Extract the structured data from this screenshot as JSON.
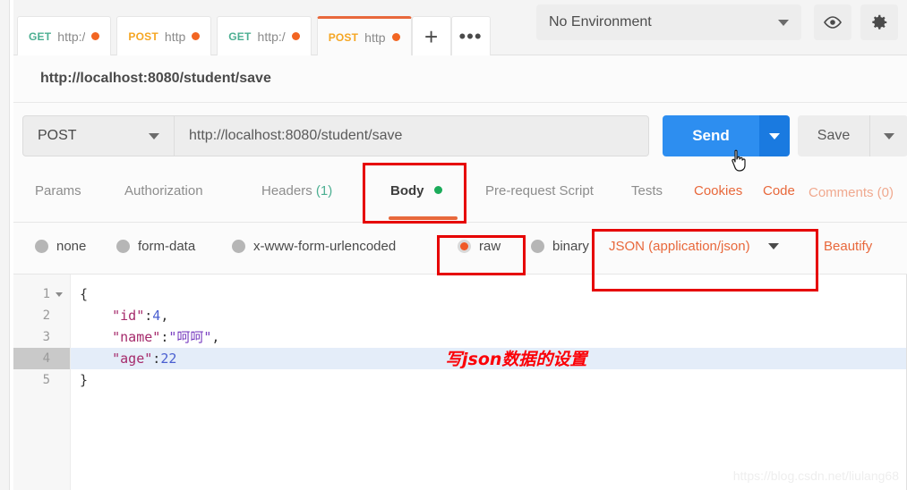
{
  "window": {
    "tabs": [
      {
        "method": "GET",
        "label": "http:/",
        "has_dot": true,
        "active": false
      },
      {
        "method": "POST",
        "label": "http",
        "has_dot": true,
        "active": false
      },
      {
        "method": "GET",
        "label": "http:/",
        "has_dot": true,
        "active": false
      },
      {
        "method": "POST",
        "label": "http",
        "has_dot": true,
        "active": true
      }
    ],
    "new_tab_label": "+",
    "more_tabs_label": "•••",
    "environment": {
      "selected": "No Environment",
      "eye_icon": "eye-icon",
      "gear_icon": "gear-icon"
    }
  },
  "breadcrumb": {
    "title": "http://localhost:8080/student/save"
  },
  "request": {
    "method": "POST",
    "url": "http://localhost:8080/student/save",
    "send_label": "Send",
    "save_label": "Save"
  },
  "request_tabs": {
    "items": [
      {
        "label": "Params",
        "active": false
      },
      {
        "label": "Authorization",
        "active": false
      },
      {
        "label": "Headers",
        "active": false,
        "count": "(1)"
      },
      {
        "label": "Body",
        "active": true,
        "dot": true
      },
      {
        "label": "Pre-request Script",
        "active": false
      },
      {
        "label": "Tests",
        "active": false
      }
    ],
    "links": [
      {
        "label": "Cookies",
        "muted": false
      },
      {
        "label": "Code",
        "muted": false
      },
      {
        "label": "Comments (0)",
        "muted": true
      }
    ]
  },
  "body_options": {
    "radios": [
      {
        "label": "none",
        "selected": false
      },
      {
        "label": "form-data",
        "selected": false
      },
      {
        "label": "x-www-form-urlencoded",
        "selected": false
      },
      {
        "label": "raw",
        "selected": true
      },
      {
        "label": "binary",
        "selected": false
      }
    ],
    "content_type": "JSON (application/json)",
    "beautify_label": "Beautify"
  },
  "editor": {
    "active_line": 4,
    "lines": [
      {
        "number": "1",
        "fold": true,
        "tokens": [
          {
            "t": "{",
            "c": "punc"
          }
        ]
      },
      {
        "number": "2",
        "fold": false,
        "tokens": [
          {
            "t": "    \"id\"",
            "c": "k"
          },
          {
            "t": ":",
            "c": "punc"
          },
          {
            "t": "4",
            "c": "num"
          },
          {
            "t": ",",
            "c": "punc"
          }
        ]
      },
      {
        "number": "3",
        "fold": false,
        "tokens": [
          {
            "t": "    \"name\"",
            "c": "k"
          },
          {
            "t": ":",
            "c": "punc"
          },
          {
            "t": "\"呵呵\"",
            "c": "str"
          },
          {
            "t": ",",
            "c": "punc"
          }
        ]
      },
      {
        "number": "4",
        "fold": false,
        "tokens": [
          {
            "t": "    \"age\"",
            "c": "k"
          },
          {
            "t": ":",
            "c": "punc"
          },
          {
            "t": "22",
            "c": "num"
          }
        ]
      },
      {
        "number": "5",
        "fold": false,
        "tokens": [
          {
            "t": "}",
            "c": "punc"
          }
        ]
      }
    ]
  },
  "annotations": {
    "note": "写json数据的设置",
    "watermark": "https://blog.csdn.net/liulang68"
  }
}
